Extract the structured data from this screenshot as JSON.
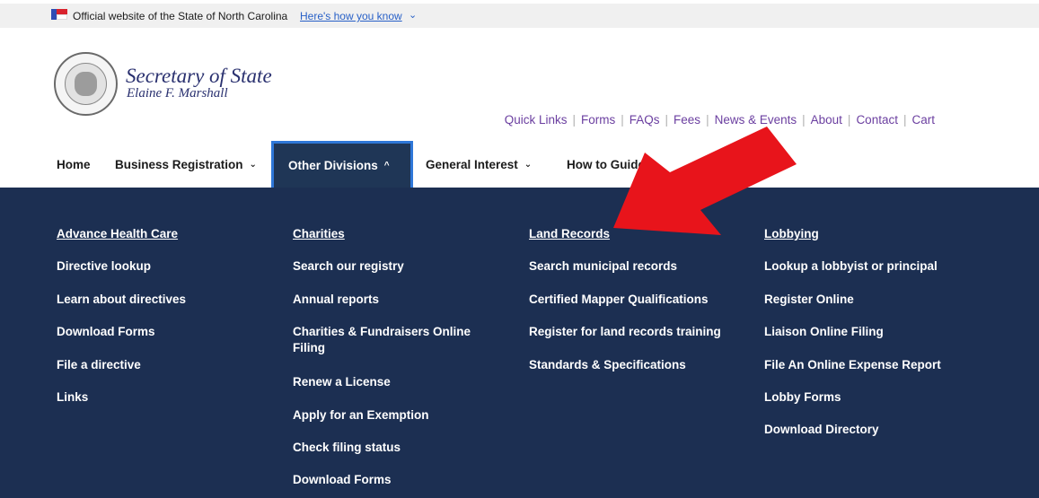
{
  "official_bar": {
    "text": "Official website of the State of North Carolina",
    "link_text": "Here's how you know",
    "chevron": "⌄"
  },
  "branding": {
    "title": "Secretary of State",
    "subtitle": "Elaine F. Marshall"
  },
  "utility_links": [
    "Quick Links",
    "Forms",
    "FAQs",
    "Fees",
    "News & Events",
    "About",
    "Contact",
    "Cart"
  ],
  "main_nav": {
    "home": "Home",
    "business_registration": "Business Registration",
    "other_divisions": "Other Divisions",
    "general_interest": "General Interest",
    "how_to_guides": "How to Guides",
    "chevron_down": "⌄",
    "chevron_up": "^"
  },
  "dropdown": {
    "advance_health_care": {
      "heading": "Advance Health Care",
      "links": [
        "Directive lookup",
        "Learn about directives",
        "Download Forms",
        "File a directive",
        "Links"
      ]
    },
    "charities": {
      "heading": "Charities",
      "links": [
        "Search our registry",
        "Annual reports",
        "Charities & Fundraisers Online Filing",
        "Renew a License",
        "Apply for an Exemption",
        "Check filing status",
        "Download Forms"
      ]
    },
    "land_records": {
      "heading": "Land Records",
      "links": [
        "Search municipal records",
        "Certified Mapper Qualifications",
        "Register for land records training",
        "Standards & Specifications"
      ]
    },
    "lobbying": {
      "heading": "Lobbying",
      "links": [
        "Lookup a lobbyist or principal",
        "Register Online",
        "Liaison Online Filing",
        "File An Online Expense Report",
        "Lobby Forms",
        "Download Directory"
      ]
    }
  },
  "colors": {
    "dropdown_bg": "#1c2f52",
    "active_tab_border": "#2e77d8",
    "utility_link": "#6b3fa0",
    "brand_text": "#29306f",
    "annotation_arrow": "#e8141b"
  }
}
